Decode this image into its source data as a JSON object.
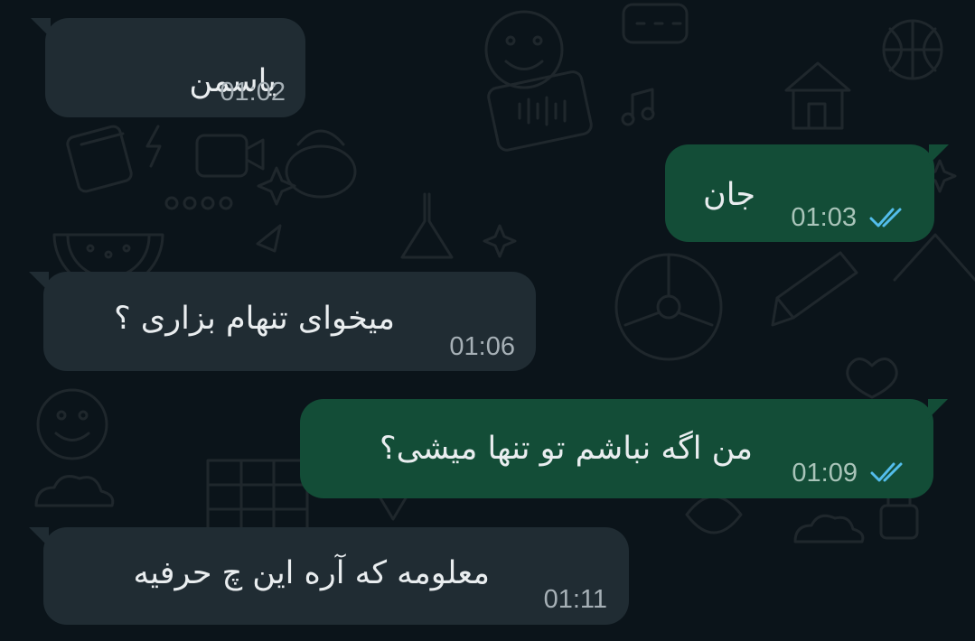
{
  "theme": {
    "background": "#0b141a",
    "incoming_bubble": "#202c33",
    "outgoing_bubble": "#134d37",
    "text": "#e9edef",
    "timestamp": "#a6b0b6",
    "read_tick": "#53bdeb"
  },
  "messages": [
    {
      "direction": "incoming",
      "text": "یاسمن",
      "time": "01:02"
    },
    {
      "direction": "outgoing",
      "text": "جان",
      "time": "01:03",
      "status": "read",
      "status_icon": "double-check-icon"
    },
    {
      "direction": "incoming",
      "text": "میخوای تنهام بزاری ؟",
      "time": "01:06"
    },
    {
      "direction": "outgoing",
      "text": "من اگه نباشم تو تنها میشی؟",
      "time": "01:09",
      "status": "read",
      "status_icon": "double-check-icon"
    },
    {
      "direction": "incoming",
      "text": "معلومه که آره این چ حرفیه",
      "time": "01:11"
    }
  ]
}
